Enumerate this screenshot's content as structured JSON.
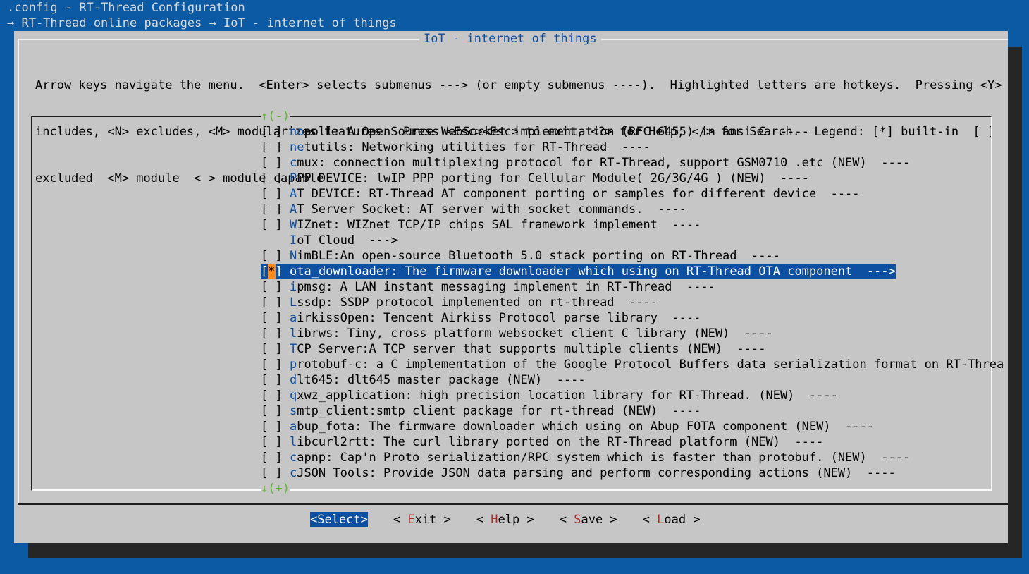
{
  "window": {
    "title": ".config - RT-Thread Configuration",
    "breadcrumb": "→ RT-Thread online packages → IoT - internet of things"
  },
  "dialog": {
    "title": "IoT - internet of things",
    "help_lines": [
      "Arrow keys navigate the menu.  <Enter> selects submenus ---> (or empty submenus ----).  Highlighted letters are hotkeys.  Pressing <Y>",
      "includes, <N> excludes, <M> modularizes features.  Press <Esc><Esc> to exit, <?> for Help, </> for Search.  Legend: [*] built-in  [ ]",
      "excluded  <M> module  < > module capable"
    ],
    "scroll_up": "↑(-)",
    "scroll_down": "↓(+)"
  },
  "menu": {
    "items": [
      {
        "prefix": "[ ] ",
        "hotkey": "no",
        "rest": "poll: A OpenSource WebSocket implementation (RFC 6455) in ansi C  ----"
      },
      {
        "prefix": "[ ] ",
        "hotkey": "ne",
        "rest": "tutils: Networking utilities for RT-Thread  ----"
      },
      {
        "prefix": "[ ] ",
        "hotkey": "c",
        "rest": "mux: connection multiplexing protocol for RT-Thread, support GSM0710 .etc (NEW)  ----"
      },
      {
        "prefix": "[ ] ",
        "hotkey": "P",
        "rest": "PP DEVICE: lwIP PPP porting for Cellular Module( 2G/3G/4G ) (NEW)  ----"
      },
      {
        "prefix": "[ ] ",
        "hotkey": "A",
        "rest": "T DEVICE: RT-Thread AT component porting or samples for different device  ----"
      },
      {
        "prefix": "[ ] ",
        "hotkey": "A",
        "rest": "T Server Socket: AT server with socket commands.  ----"
      },
      {
        "prefix": "[ ] ",
        "hotkey": "W",
        "rest": "IZnet: WIZnet TCP/IP chips SAL framework implement  ----"
      },
      {
        "prefix": "    ",
        "hotkey": "I",
        "rest": "oT Cloud  --->"
      },
      {
        "prefix": "[ ] ",
        "hotkey": "N",
        "rest": "imBLE:An open-source Bluetooth 5.0 stack porting on RT-Thread  ----"
      },
      {
        "prefix": "[",
        "star": "*",
        "prefix2": "] ",
        "hotkey": "o",
        "rest": "ta_downloader: The firmware downloader which using on RT-Thread OTA component  --->",
        "selected": true
      },
      {
        "prefix": "[ ] ",
        "hotkey": "i",
        "rest": "pmsg: A LAN instant messaging implement in RT-Thread  ----"
      },
      {
        "prefix": "[ ] ",
        "hotkey": "L",
        "rest": "ssdp: SSDP protocol implemented on rt-thread  ----"
      },
      {
        "prefix": "[ ] ",
        "hotkey": "a",
        "rest": "irkissOpen: Tencent Airkiss Protocol parse library  ----"
      },
      {
        "prefix": "[ ] ",
        "hotkey": "l",
        "rest": "ibrws: Tiny, cross platform websocket client C library (NEW)  ----"
      },
      {
        "prefix": "[ ] ",
        "hotkey": "T",
        "rest": "CP Server:A TCP server that supports multiple clients (NEW)  ----"
      },
      {
        "prefix": "[ ] ",
        "hotkey": "p",
        "rest": "rotobuf-c: a C implementation of the Google Protocol Buffers data serialization format on RT-Threa"
      },
      {
        "prefix": "[ ] ",
        "hotkey": "d",
        "rest": "lt645: dlt645 master package (NEW)  ----"
      },
      {
        "prefix": "[ ] ",
        "hotkey": "q",
        "rest": "xwz_application: high precision location library for RT-Thread. (NEW)  ----"
      },
      {
        "prefix": "[ ] ",
        "hotkey": "s",
        "rest": "mtp_client:smtp client package for rt-thread (NEW)  ----"
      },
      {
        "prefix": "[ ] ",
        "hotkey": "a",
        "rest": "bup_fota: The firmware downloader which using on Abup FOTA component (NEW)  ----"
      },
      {
        "prefix": "[ ] ",
        "hotkey": "l",
        "rest": "ibcurl2rtt: The curl library ported on the RT-Thread platform (NEW)  ----"
      },
      {
        "prefix": "[ ] ",
        "hotkey": "c",
        "rest": "apnp: Cap'n Proto serialization/RPC system which is faster than protobuf. (NEW)  ----"
      },
      {
        "prefix": "[ ] ",
        "hotkey": "c",
        "rest": "JSON Tools: Provide JSON data parsing and perform corresponding actions (NEW)  ----"
      }
    ]
  },
  "buttons": [
    {
      "name": "select",
      "text": "<Select>",
      "active": true
    },
    {
      "name": "exit",
      "pre": "< ",
      "hotkey": "E",
      "rest": "xit >"
    },
    {
      "name": "help",
      "pre": "< ",
      "hotkey": "H",
      "rest": "elp >"
    },
    {
      "name": "save",
      "pre": "< ",
      "hotkey": "S",
      "rest": "ave >"
    },
    {
      "name": "load",
      "pre": "< ",
      "hotkey": "L",
      "rest": "oad >"
    }
  ],
  "colors": {
    "background": "#0b5aa3",
    "dialog": "#c6c6c6",
    "accent": "#0d4fa1",
    "hotkey_button": "#b22b2b",
    "scroll_arrow": "#5fb82a",
    "star_highlight": "#ff8a1f"
  }
}
